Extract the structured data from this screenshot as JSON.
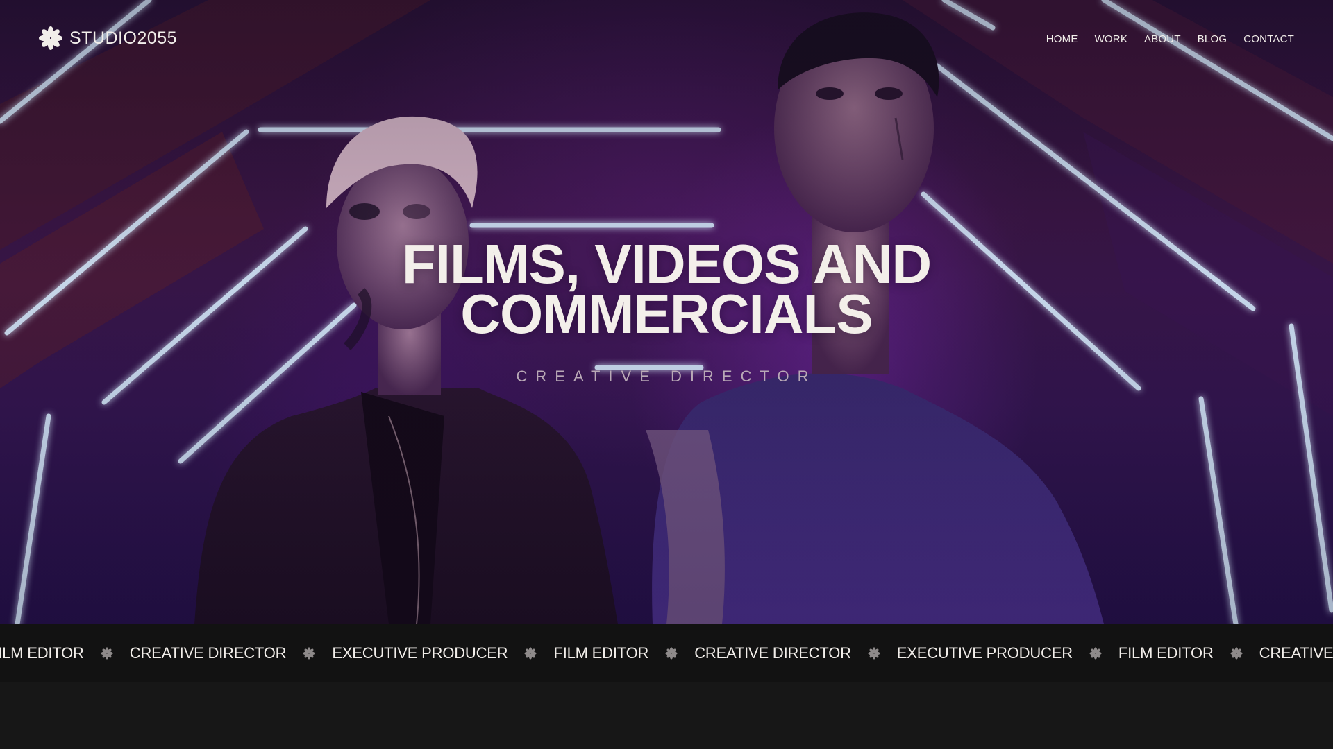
{
  "brand": {
    "name": "STUDIO2055",
    "icon": "asterisk-flower-icon"
  },
  "nav": {
    "items": [
      {
        "label": "HOME"
      },
      {
        "label": "WORK"
      },
      {
        "label": "ABOUT"
      },
      {
        "label": "BLOG"
      },
      {
        "label": "CONTACT"
      }
    ]
  },
  "hero": {
    "title_line1": "FILMS, VIDEOS AND",
    "title_line2": "COMMERCIALS",
    "subtitle": "CREATIVE DIRECTOR",
    "background": "video still: two people in a neon-lit tunnel"
  },
  "ticker": {
    "separator_icon": "asterisk-flower-icon",
    "items": [
      "FILM EDITOR",
      "CREATIVE DIRECTOR",
      "EXECUTIVE PRODUCER",
      "FILM EDITOR",
      "CREATIVE DIRECTOR",
      "EXECUTIVE PRODUCER",
      "FILM EDITOR",
      "CREATIVE DIRECTOR"
    ]
  },
  "colors": {
    "text": "#f2eeea",
    "subtitle": "#b9a9b6",
    "ticker_bg": "#121212",
    "page_bg": "#171717",
    "neon": "#cfe6ff",
    "hero_tint": "#3b1646"
  }
}
